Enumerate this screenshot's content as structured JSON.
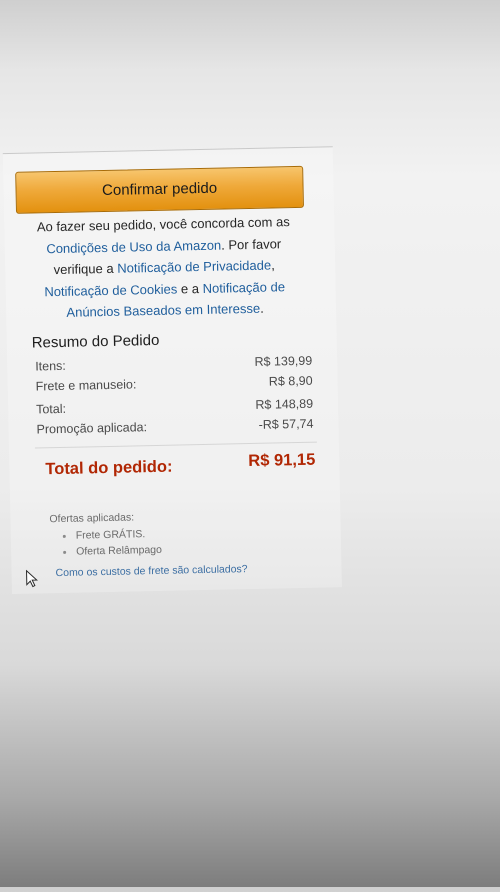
{
  "confirm_button": {
    "label": "Confirmar pedido",
    "color": "#efa93a"
  },
  "terms": {
    "prefix": "Ao fazer seu pedido, você concorda com as",
    "conditions_link": "Condições de Uso da Amazon",
    "mid1": ". Por favor verifique a",
    "privacy_link": "Notificação de Privacidade",
    "mid2": ",",
    "cookies_link": "Notificação de Cookies",
    "mid3": "e a",
    "ads_link": "Notificação de Anúncios Baseados em Interesse",
    "suffix": "."
  },
  "summary": {
    "title": "Resumo do Pedido",
    "rows": [
      {
        "label": "Itens:",
        "value": "R$ 139,99"
      },
      {
        "label": "Frete e manuseio:",
        "value": "R$ 8,90"
      },
      {
        "label": "Total:",
        "value": "R$ 148,89"
      },
      {
        "label": "Promoção aplicada:",
        "value": "-R$ 57,74"
      }
    ],
    "total_label": "Total do pedido:",
    "total_value": "R$ 91,15",
    "total_color": "#b12704"
  },
  "offers": {
    "heading": "Ofertas aplicadas:",
    "items": [
      "Frete GRÁTIS.",
      "Oferta Relâmpago"
    ]
  },
  "shipping_link": "Como os custos de frete são calculados?",
  "icons": [
    "mouse-pointer-icon"
  ]
}
